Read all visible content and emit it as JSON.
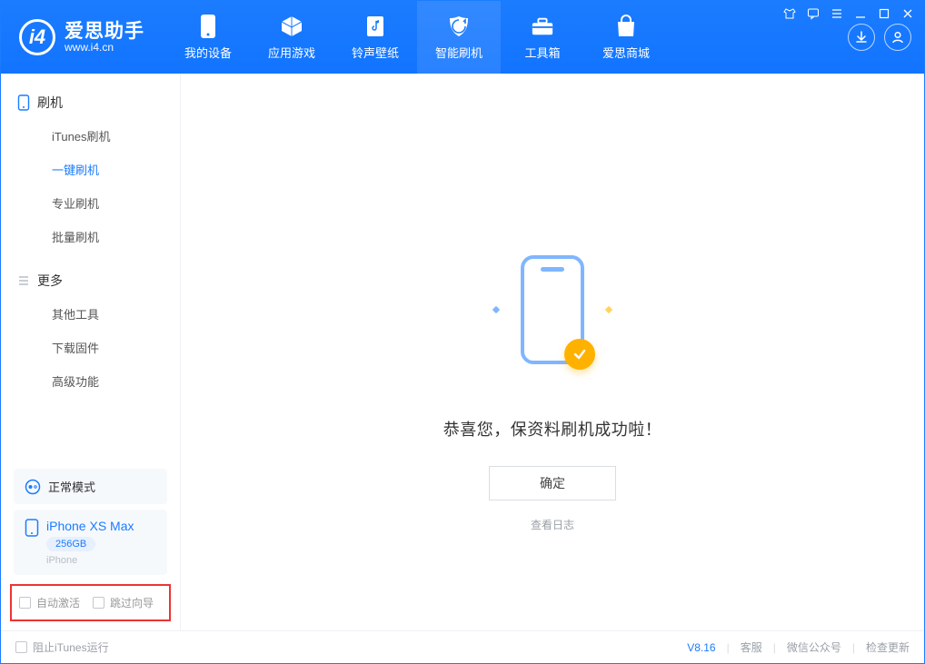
{
  "app": {
    "name": "爱思助手",
    "domain": "www.i4.cn"
  },
  "nav": {
    "items": [
      {
        "label": "我的设备",
        "icon": "device"
      },
      {
        "label": "应用游戏",
        "icon": "cube"
      },
      {
        "label": "铃声壁纸",
        "icon": "note"
      },
      {
        "label": "智能刷机",
        "icon": "shield",
        "active": true
      },
      {
        "label": "工具箱",
        "icon": "toolbox"
      },
      {
        "label": "爱思商城",
        "icon": "bag"
      }
    ]
  },
  "sidebar": {
    "group_flash": "刷机",
    "flash_items": [
      {
        "label": "iTunes刷机"
      },
      {
        "label": "一键刷机",
        "active": true
      },
      {
        "label": "专业刷机"
      },
      {
        "label": "批量刷机"
      }
    ],
    "group_more": "更多",
    "more_items": [
      {
        "label": "其他工具"
      },
      {
        "label": "下载固件"
      },
      {
        "label": "高级功能"
      }
    ],
    "mode_label": "正常模式",
    "device": {
      "name": "iPhone XS Max",
      "capacity": "256GB",
      "type": "iPhone"
    },
    "options": {
      "auto_activate": "自动激活",
      "skip_guide": "跳过向导"
    }
  },
  "main": {
    "success_message": "恭喜您，保资料刷机成功啦！",
    "ok_button": "确定",
    "view_log": "查看日志"
  },
  "footer": {
    "block_itunes": "阻止iTunes运行",
    "version": "V8.16",
    "links": {
      "support": "客服",
      "wechat": "微信公众号",
      "update": "检查更新"
    }
  }
}
